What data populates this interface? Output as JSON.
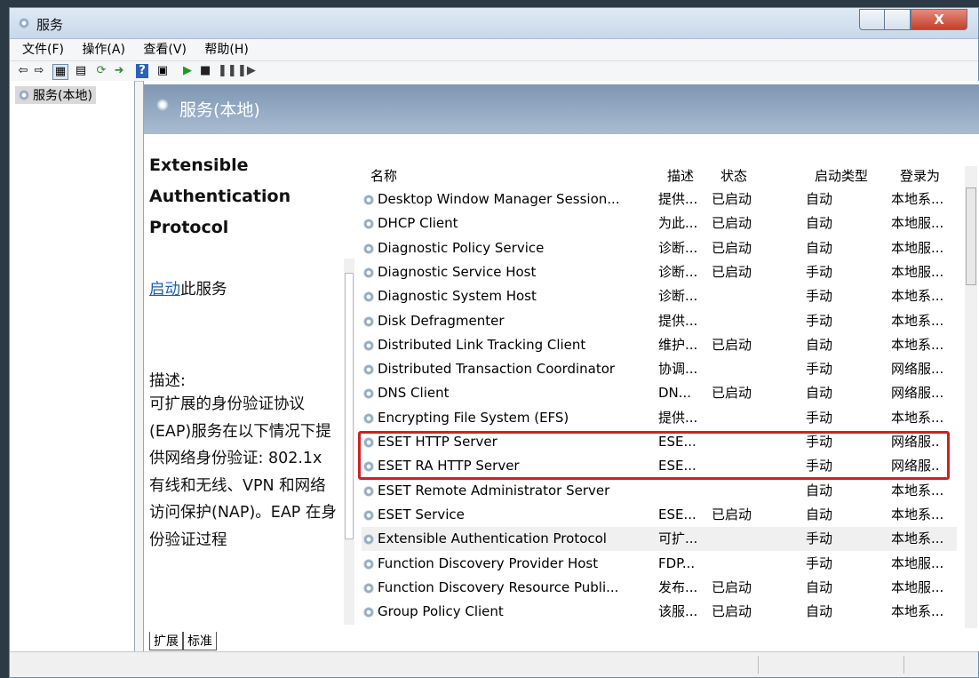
{
  "window": {
    "title": "服务",
    "close_glyph": "X"
  },
  "menu": [
    "文件(F)",
    "操作(A)",
    "查看(V)",
    "帮助(H)"
  ],
  "tree": {
    "root": "服务(本地)"
  },
  "header": {
    "title": "服务(本地)"
  },
  "description": {
    "service_name": "Extensible Authentication Protocol",
    "start_link": "启动",
    "start_suffix": "此服务",
    "label": "描述:",
    "text": "可扩展的身份验证协议(EAP)服务在以下情况下提供网络身份验证: 802.1x 有线和无线、VPN 和网络访问保护(NAP)。EAP 在身份验证过程"
  },
  "columns": [
    "名称",
    "描述",
    "状态",
    "启动类型",
    "登录为"
  ],
  "services": [
    {
      "name": "Desktop Window Manager Session...",
      "desc": "提供...",
      "status": "已启动",
      "startup": "自动",
      "logon": "本地系..."
    },
    {
      "name": "DHCP Client",
      "desc": "为此...",
      "status": "已启动",
      "startup": "自动",
      "logon": "本地服..."
    },
    {
      "name": "Diagnostic Policy Service",
      "desc": "诊断...",
      "status": "已启动",
      "startup": "自动",
      "logon": "本地服..."
    },
    {
      "name": "Diagnostic Service Host",
      "desc": "诊断...",
      "status": "已启动",
      "startup": "手动",
      "logon": "本地服..."
    },
    {
      "name": "Diagnostic System Host",
      "desc": "诊断...",
      "status": "",
      "startup": "手动",
      "logon": "本地系..."
    },
    {
      "name": "Disk Defragmenter",
      "desc": "提供...",
      "status": "",
      "startup": "手动",
      "logon": "本地系..."
    },
    {
      "name": "Distributed Link Tracking Client",
      "desc": "维护...",
      "status": "已启动",
      "startup": "自动",
      "logon": "本地系..."
    },
    {
      "name": "Distributed Transaction Coordinator",
      "desc": "协调...",
      "status": "",
      "startup": "手动",
      "logon": "网络服..."
    },
    {
      "name": "DNS Client",
      "desc": "DN...",
      "status": "已启动",
      "startup": "自动",
      "logon": "网络服..."
    },
    {
      "name": "Encrypting File System (EFS)",
      "desc": "提供...",
      "status": "",
      "startup": "手动",
      "logon": "本地系..."
    },
    {
      "name": "ESET HTTP Server",
      "desc": "ESE...",
      "status": "",
      "startup": "手动",
      "logon": "网络服.."
    },
    {
      "name": "ESET RA HTTP Server",
      "desc": "ESE...",
      "status": "",
      "startup": "手动",
      "logon": "网络服.."
    },
    {
      "name": "ESET Remote Administrator Server",
      "desc": "",
      "status": "",
      "startup": "自动",
      "logon": "本地系..."
    },
    {
      "name": "ESET Service",
      "desc": "ESE...",
      "status": "已启动",
      "startup": "自动",
      "logon": "本地系..."
    },
    {
      "name": "Extensible Authentication Protocol",
      "desc": "可扩...",
      "status": "",
      "startup": "手动",
      "logon": "本地系..."
    },
    {
      "name": "Function Discovery Provider Host",
      "desc": "FDP...",
      "status": "",
      "startup": "手动",
      "logon": "本地服..."
    },
    {
      "name": "Function Discovery Resource Publi...",
      "desc": "发布...",
      "status": "已启动",
      "startup": "自动",
      "logon": "本地服..."
    },
    {
      "name": "Group Policy Client",
      "desc": "该服...",
      "status": "已启动",
      "startup": "自动",
      "logon": "本地系..."
    }
  ],
  "selected_index": 14,
  "tabs": [
    "扩展",
    "标准"
  ],
  "highlight_color": "#d12020"
}
